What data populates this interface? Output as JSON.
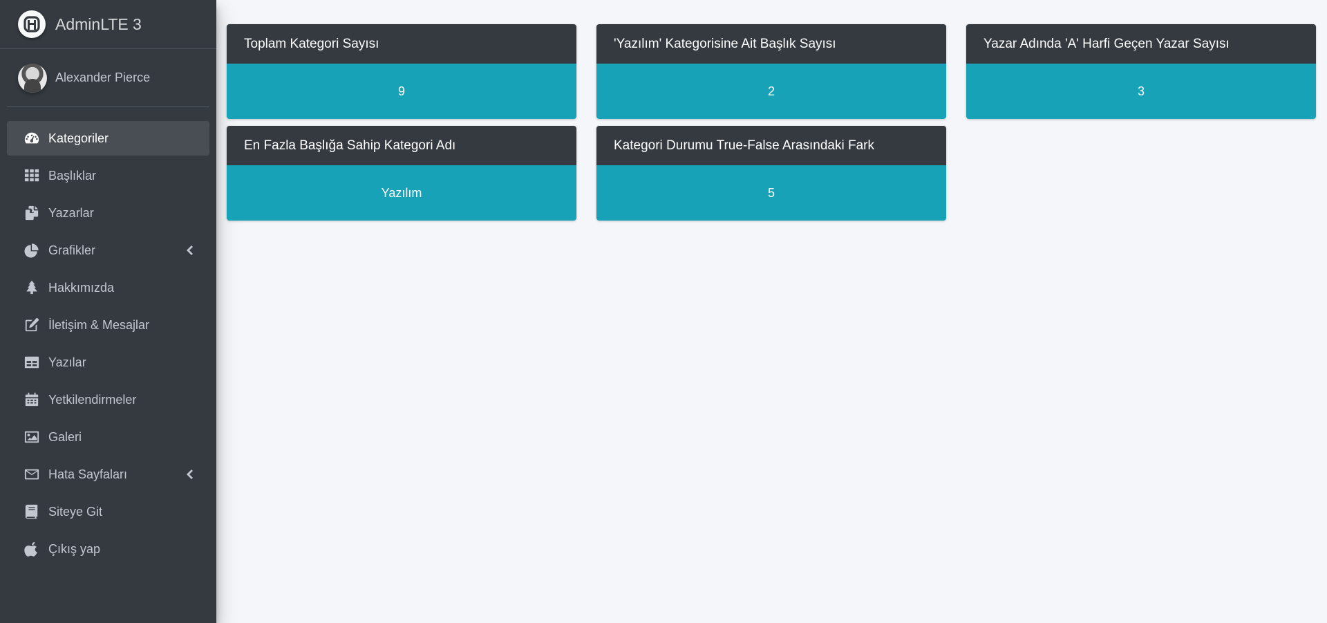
{
  "brand": {
    "name": "AdminLTE 3"
  },
  "user": {
    "name": "Alexander Pierce"
  },
  "sidebar": {
    "items": [
      {
        "label": "Kategoriler",
        "icon": "dashboard-icon",
        "active": true
      },
      {
        "label": "Başlıklar",
        "icon": "grid-icon"
      },
      {
        "label": "Yazarlar",
        "icon": "copy-icon"
      },
      {
        "label": "Grafikler",
        "icon": "pie-chart-icon",
        "has_submenu": true
      },
      {
        "label": "Hakkımızda",
        "icon": "tree-icon"
      },
      {
        "label": "İletişim & Mesajlar",
        "icon": "edit-icon"
      },
      {
        "label": "Yazılar",
        "icon": "table-icon"
      },
      {
        "label": "Yetkilendirmeler",
        "icon": "calendar-icon"
      },
      {
        "label": "Galeri",
        "icon": "image-icon"
      },
      {
        "label": "Hata Sayfaları",
        "icon": "envelope-icon",
        "has_submenu": true
      },
      {
        "label": "Siteye Git",
        "icon": "book-icon"
      },
      {
        "label": "Çıkış yap",
        "icon": "apple-icon"
      }
    ]
  },
  "cards": [
    {
      "title": "Toplam Kategori Sayısı",
      "value": "9"
    },
    {
      "title": "'Yazılım' Kategorisine Ait Başlık Sayısı",
      "value": "2"
    },
    {
      "title": "Yazar Adında 'A' Harfi Geçen Yazar Sayısı",
      "value": "3"
    },
    {
      "title": "En Fazla Başlığa Sahip Kategori Adı",
      "value": "Yazılım"
    },
    {
      "title": "Kategori Durumu True-False Arasındaki Fark",
      "value": "5"
    }
  ],
  "colors": {
    "sidebar_bg": "#343a40",
    "card_header_bg": "#343a40",
    "card_body_bg": "#17a2b8",
    "page_bg": "#f4f6f9"
  }
}
